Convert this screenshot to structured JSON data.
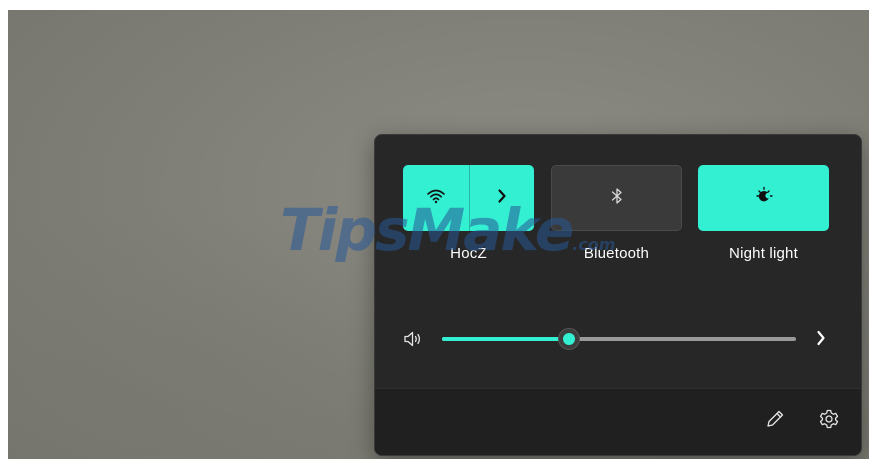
{
  "watermark": {
    "text": "TipsMake",
    "suffix": ".com"
  },
  "quick_settings": {
    "tiles": [
      {
        "id": "wifi",
        "label": "HocZ",
        "state": "on",
        "icon": "wifi-icon",
        "has_expand": true,
        "expand_icon": "chevron-right-icon"
      },
      {
        "id": "bluetooth",
        "label": "Bluetooth",
        "state": "off",
        "icon": "bluetooth-icon"
      },
      {
        "id": "night_light",
        "label": "Night light",
        "state": "on",
        "icon": "night-light-icon"
      }
    ],
    "volume": {
      "icon": "speaker-icon",
      "level_percent": 36,
      "more_icon": "chevron-right-icon"
    },
    "footer": {
      "edit_icon": "pencil-icon",
      "settings_icon": "gear-icon"
    }
  },
  "colors": {
    "accent": "#34f0d3",
    "panel_bg": "#272727",
    "footer_bg": "#202020",
    "tile_off_bg": "#3a3a3a",
    "text": "#ffffff"
  }
}
